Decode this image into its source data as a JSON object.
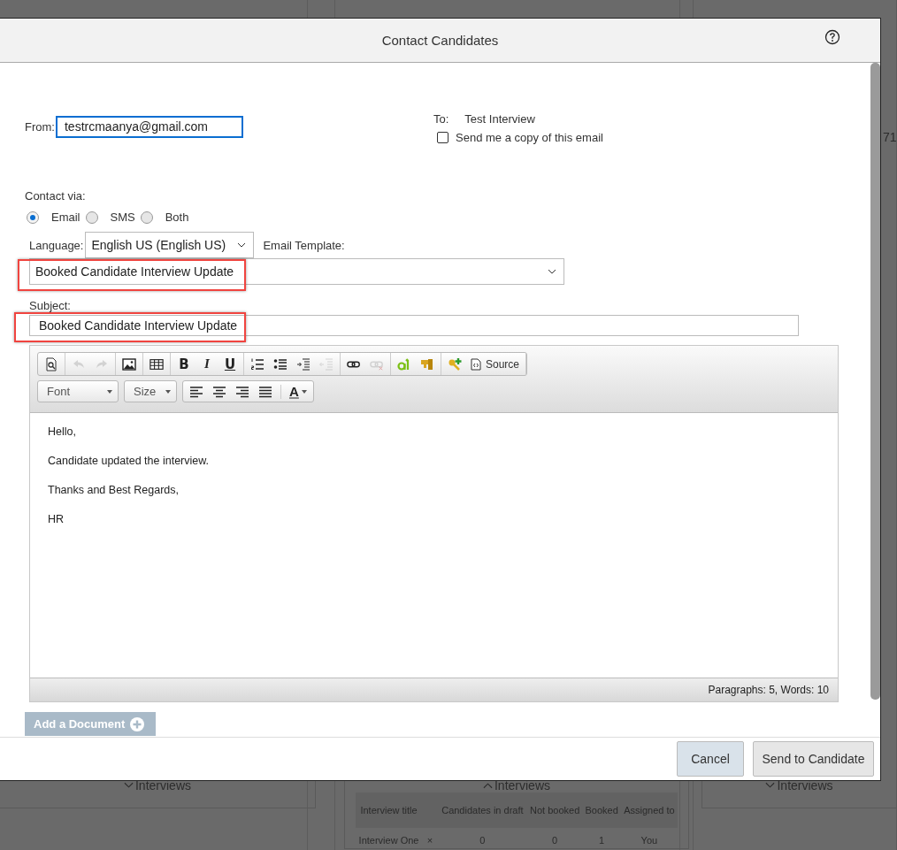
{
  "background": {
    "right_fragment": "71",
    "panels": [
      {
        "toggle": "Interviews",
        "expanded": false
      },
      {
        "toggle": "Interviews",
        "expanded": true
      },
      {
        "toggle": "Interviews",
        "expanded": false
      }
    ],
    "table": {
      "columns": [
        "Interview title",
        "",
        "Candidates in draft",
        "Not booked",
        "Booked",
        "Assigned to"
      ],
      "rows": [
        [
          "Interview One",
          "×",
          "0",
          "0",
          "1",
          "You"
        ]
      ]
    }
  },
  "dialog": {
    "title": "Contact Candidates",
    "from": {
      "label": "From:",
      "value": "testrcmaanya@gmail.com"
    },
    "to": {
      "label": "To:",
      "value": "Test Interview"
    },
    "copy": {
      "label": "Send me a copy of this email",
      "checked": false
    },
    "contact_via": {
      "label": "Contact via:",
      "options": [
        {
          "label": "Email",
          "selected": true
        },
        {
          "label": "SMS",
          "selected": false
        },
        {
          "label": "Both",
          "selected": false
        }
      ]
    },
    "language": {
      "label": "Language:",
      "value": "English US (English US)"
    },
    "template": {
      "label": "Email Template:",
      "value": "Booked Candidate Interview Update"
    },
    "subject": {
      "label": "Subject:",
      "value": "Booked Candidate Interview Update"
    },
    "toolbar": {
      "rows": [
        {
          "groups": [
            {
              "items": [
                {
                  "kind": "preview",
                  "disabled": false
                }
              ]
            },
            {
              "items": [
                {
                  "kind": "undo",
                  "disabled": true
                },
                {
                  "kind": "redo",
                  "disabled": true
                }
              ]
            },
            {
              "items": [
                {
                  "kind": "image",
                  "disabled": false
                }
              ]
            },
            {
              "items": [
                {
                  "kind": "table",
                  "disabled": false
                }
              ]
            },
            {
              "items": [
                {
                  "kind": "bold",
                  "label": "B",
                  "disabled": false
                },
                {
                  "kind": "italic",
                  "label": "I",
                  "disabled": false
                },
                {
                  "kind": "underline",
                  "label": "U",
                  "disabled": false
                }
              ]
            },
            {
              "items": [
                {
                  "kind": "numbered-list",
                  "disabled": false
                },
                {
                  "kind": "bullet-list",
                  "disabled": false
                },
                {
                  "kind": "indent",
                  "disabled": false
                },
                {
                  "kind": "outdent",
                  "disabled": true
                }
              ]
            },
            {
              "items": [
                {
                  "kind": "link",
                  "disabled": false
                },
                {
                  "kind": "unlink",
                  "disabled": true
                }
              ]
            },
            {
              "items": [
                {
                  "kind": "spellcheck",
                  "disabled": false
                },
                {
                  "kind": "stamp",
                  "disabled": false
                }
              ]
            },
            {
              "items": [
                {
                  "kind": "key-plus",
                  "disabled": false
                },
                {
                  "kind": "source",
                  "label": "Source",
                  "disabled": false
                }
              ]
            }
          ]
        },
        {
          "groups": [
            {
              "items": [
                {
                  "kind": "combo",
                  "label": "Font",
                  "disabled": false
                }
              ]
            },
            {
              "items": [
                {
                  "kind": "combo",
                  "label": "Size",
                  "disabled": false
                }
              ]
            },
            {
              "items": [
                {
                  "kind": "align-left",
                  "disabled": false
                },
                {
                  "kind": "align-center",
                  "disabled": false
                },
                {
                  "kind": "align-right",
                  "disabled": false
                },
                {
                  "kind": "align-justify",
                  "disabled": false
                },
                {
                  "kind": "color",
                  "label": "A",
                  "disabled": false
                }
              ]
            }
          ]
        }
      ]
    },
    "body": [
      "Hello,",
      "Candidate updated the interview.",
      "Thanks and Best Regards,",
      "HR"
    ],
    "status": "Paragraphs: 5, Words: 10",
    "add_document": "Add a Document",
    "buttons": [
      {
        "label": "Cancel",
        "kind": "secondary"
      },
      {
        "label": "Send to Candidate",
        "kind": "primary"
      }
    ]
  }
}
